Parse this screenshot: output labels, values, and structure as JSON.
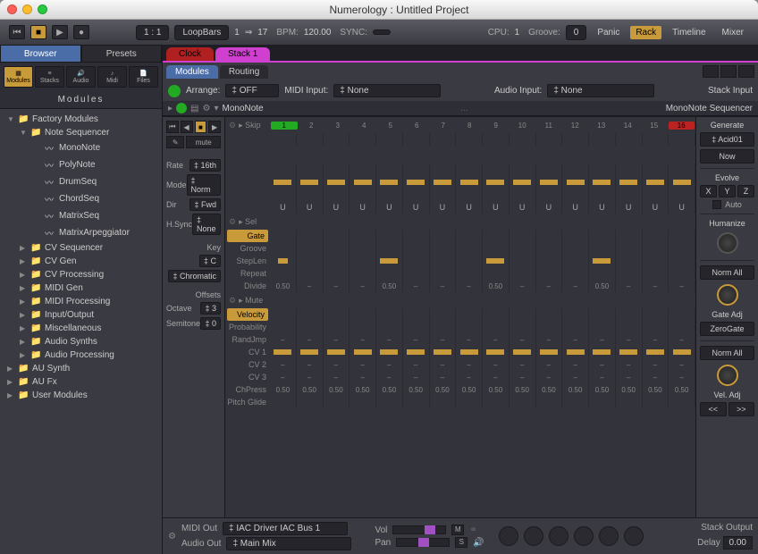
{
  "window": {
    "title": "Numerology : Untitled Project"
  },
  "toolbar": {
    "position": "1 : 1",
    "loop_label": "LoopBars",
    "loop_from": "1",
    "loop_arrow": "⇒",
    "loop_to": "17",
    "bpm_label": "BPM:",
    "bpm": "120.00",
    "sync_label": "SYNC:",
    "sync": "",
    "cpu_label": "CPU:",
    "cpu": "1",
    "groove_label": "Groove:",
    "groove": "0",
    "panic": "Panic",
    "views": {
      "rack": "Rack",
      "timeline": "Timeline",
      "mixer": "Mixer"
    }
  },
  "sidebar": {
    "tabs": [
      "Browser",
      "Presets"
    ],
    "icons": [
      "Modules",
      "Stacks",
      "Audio",
      "Midi",
      "Files"
    ],
    "header": "Modules",
    "tree": [
      {
        "d": 1,
        "exp": true,
        "icon": "folder",
        "label": "Factory Modules"
      },
      {
        "d": 2,
        "exp": true,
        "icon": "folder",
        "label": "Note Sequencer"
      },
      {
        "d": 3,
        "icon": "module",
        "label": "MonoNote"
      },
      {
        "d": 3,
        "icon": "module",
        "label": "PolyNote"
      },
      {
        "d": 3,
        "icon": "module",
        "label": "DrumSeq"
      },
      {
        "d": 3,
        "icon": "module",
        "label": "ChordSeq"
      },
      {
        "d": 3,
        "icon": "module",
        "label": "MatrixSeq"
      },
      {
        "d": 3,
        "icon": "module",
        "label": "MatrixArpeggiator"
      },
      {
        "d": 2,
        "exp": false,
        "icon": "folder",
        "label": "CV Sequencer"
      },
      {
        "d": 2,
        "exp": false,
        "icon": "folder",
        "label": "CV Gen"
      },
      {
        "d": 2,
        "exp": false,
        "icon": "folder",
        "label": "CV Processing"
      },
      {
        "d": 2,
        "exp": false,
        "icon": "folder",
        "label": "MIDI Gen"
      },
      {
        "d": 2,
        "exp": false,
        "icon": "folder",
        "label": "MIDI Processing"
      },
      {
        "d": 2,
        "exp": false,
        "icon": "folder",
        "label": "Input/Output"
      },
      {
        "d": 2,
        "exp": false,
        "icon": "folder",
        "label": "Miscellaneous"
      },
      {
        "d": 2,
        "exp": false,
        "icon": "folder",
        "label": "Audio Synths"
      },
      {
        "d": 2,
        "exp": false,
        "icon": "folder",
        "label": "Audio Processing"
      },
      {
        "d": 1,
        "exp": false,
        "icon": "folder",
        "label": "AU Synth"
      },
      {
        "d": 1,
        "exp": false,
        "icon": "folder",
        "label": "AU Fx"
      },
      {
        "d": 1,
        "exp": false,
        "icon": "folder",
        "label": "User Modules"
      }
    ]
  },
  "main": {
    "tabs": {
      "clock": "Clock",
      "stack": "Stack 1"
    },
    "sub_tabs": [
      "Modules",
      "Routing"
    ],
    "io": {
      "arrange_label": "Arrange:",
      "arrange": "OFF",
      "midi_in_label": "MIDI Input:",
      "midi_in": "None",
      "audio_in_label": "Audio Input:",
      "audio_in": "None",
      "stack_input": "Stack Input"
    },
    "module": {
      "name": "MonoNote",
      "type": "MonoNote Sequencer",
      "dots": "..."
    }
  },
  "seq": {
    "mute": "mute",
    "params": {
      "rate_label": "Rate",
      "rate": "16th",
      "mode_label": "Mode",
      "mode": "Norm",
      "dir_label": "Dir",
      "dir": "Fwd",
      "hsync_label": "H.Sync",
      "hsync": "None",
      "key_label": "Key",
      "key": "C",
      "scale": "Chromatic",
      "offsets_label": "Offsets",
      "octave_label": "Octave",
      "octave": "3",
      "semitone_label": "Semitone",
      "semitone": "0"
    },
    "steps": [
      "1",
      "2",
      "3",
      "4",
      "5",
      "6",
      "7",
      "8",
      "9",
      "10",
      "11",
      "12",
      "13",
      "14",
      "15",
      "16"
    ],
    "lanes": {
      "skip": "Skip",
      "sel": "Sel",
      "gate": "Gate",
      "groove": "Groove",
      "steplen": "StepLen",
      "repeat": "Repeat",
      "divide": "Divide",
      "mute_lane": "Mute",
      "velocity": "Velocity",
      "probability": "Probability",
      "randjmp": "RandJmp",
      "cv1": "CV 1",
      "cv2": "CV 2",
      "cv3": "CV 3",
      "chpress": "ChPress",
      "pitchglide": "Pitch Glide"
    },
    "u": "U",
    "divide_vals": [
      "0.50",
      "–",
      "–",
      "–",
      "0.50",
      "–",
      "–",
      "–",
      "0.50",
      "–",
      "–",
      "–",
      "0.50",
      "–",
      "–",
      "–"
    ],
    "dash": "–",
    "half": "0.50"
  },
  "right": {
    "generate_label": "Generate",
    "preset": "Acid01",
    "now": "Now",
    "evolve_label": "Evolve",
    "x": "X",
    "y": "Y",
    "z": "Z",
    "auto": "Auto",
    "humanize_label": "Humanize",
    "normall": "Norm All",
    "gateadj": "Gate Adj",
    "zerogate": "ZeroGate",
    "veladj": "Vel. Adj",
    "prev": "<<",
    "next": ">>"
  },
  "footer": {
    "midi_out_label": "MIDI Out",
    "midi_out": "IAC Driver IAC Bus 1",
    "audio_out_label": "Audio Out",
    "audio_out": "Main Mix",
    "vol": "Vol",
    "pan": "Pan",
    "m": "M",
    "s": "S",
    "stack_output": "Stack Output",
    "delay_label": "Delay",
    "delay": "0.00"
  }
}
